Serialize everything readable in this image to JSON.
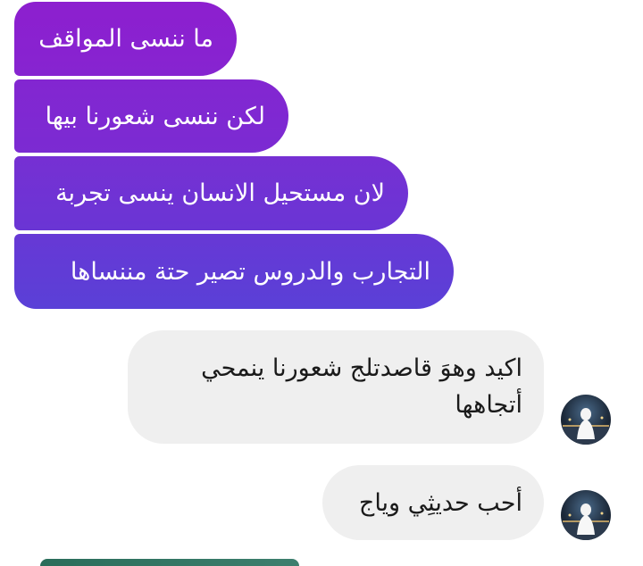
{
  "colors": {
    "sent_gradient_top": "#8a22cf",
    "sent_gradient_bottom": "#5b3fd6",
    "received_bubble": "#efefef",
    "received_text": "#1a1a1a"
  },
  "messages": {
    "sent": [
      {
        "text": "ما ننسى المواقف"
      },
      {
        "text": "لكن ننسى شعورنا بيها"
      },
      {
        "text": "لان مستحيل الانسان ينسى تجربة"
      },
      {
        "text": "التجارب والدروس تصير حتة مننساها"
      }
    ],
    "received": [
      {
        "text_line1": "اكيد وهوَ قاصدتلج شعورنا ينمحي",
        "text_line2": "أتجاهها",
        "avatar_icon": "user-avatar"
      },
      {
        "text": "أحب حديثِي وياج",
        "avatar_icon": "user-avatar"
      }
    ]
  }
}
